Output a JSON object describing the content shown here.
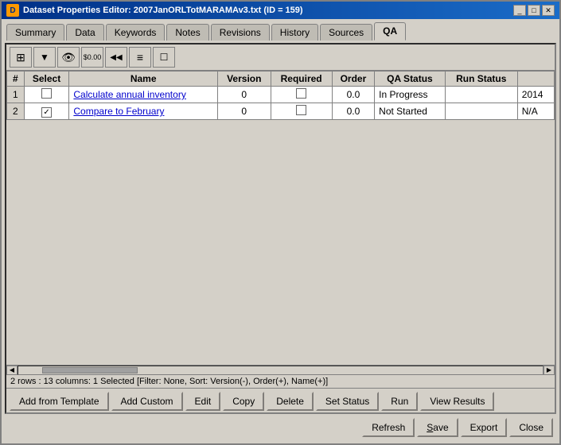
{
  "window": {
    "title": "Dataset Properties Editor: 2007JanORLTotMARAMAv3.txt (ID = 159)",
    "app_icon": "D"
  },
  "title_buttons": {
    "minimize": "_",
    "restore": "□",
    "close": "✕"
  },
  "tabs": [
    {
      "id": "summary",
      "label": "Summary",
      "active": false
    },
    {
      "id": "data",
      "label": "Data",
      "active": false
    },
    {
      "id": "keywords",
      "label": "Keywords",
      "active": false
    },
    {
      "id": "notes",
      "label": "Notes",
      "active": false
    },
    {
      "id": "revisions",
      "label": "Revisions",
      "active": false
    },
    {
      "id": "history",
      "label": "History",
      "active": false
    },
    {
      "id": "sources",
      "label": "Sources",
      "active": false
    },
    {
      "id": "qa",
      "label": "QA",
      "active": true
    }
  ],
  "toolbar_icons": [
    {
      "id": "columns-icon",
      "symbol": "⊞"
    },
    {
      "id": "filter-icon",
      "symbol": "▼"
    },
    {
      "id": "eye-icon",
      "symbol": "👁"
    },
    {
      "id": "price-icon",
      "symbol": "$0.00"
    },
    {
      "id": "rewind-icon",
      "symbol": "◀◀"
    },
    {
      "id": "list-icon",
      "symbol": "≡"
    },
    {
      "id": "checkbox-icon",
      "symbol": "☐"
    }
  ],
  "table": {
    "columns": [
      "#",
      "Select",
      "Name",
      "Version",
      "Required",
      "Order",
      "QA Status",
      "Run Status",
      ""
    ],
    "rows": [
      {
        "num": "1",
        "select": false,
        "name": "Calculate annual inventory",
        "version": "0",
        "required": false,
        "order": "0.0",
        "qa_status": "In Progress",
        "run_status": "",
        "extra": "2014"
      },
      {
        "num": "2",
        "select": true,
        "name": "Compare to February",
        "version": "0",
        "required": false,
        "order": "0.0",
        "qa_status": "Not Started",
        "run_status": "",
        "extra": "N/A"
      }
    ]
  },
  "status_bar": "2 rows : 13 columns: 1 Selected [Filter: None, Sort: Version(-), Order(+), Name(+)]",
  "bottom_toolbar1": {
    "buttons": [
      {
        "id": "add-template-btn",
        "label": "Add from Template"
      },
      {
        "id": "add-custom-btn",
        "label": "Add Custom"
      },
      {
        "id": "edit-btn",
        "label": "Edit"
      },
      {
        "id": "copy-btn",
        "label": "Copy"
      },
      {
        "id": "delete-btn",
        "label": "Delete"
      },
      {
        "id": "set-status-btn",
        "label": "Set Status"
      },
      {
        "id": "run-btn",
        "label": "Run"
      },
      {
        "id": "view-results-btn",
        "label": "View Results"
      }
    ]
  },
  "bottom_toolbar2": {
    "buttons": [
      {
        "id": "refresh-btn",
        "label": "Refresh"
      },
      {
        "id": "save-btn",
        "label": "Save"
      },
      {
        "id": "export-btn",
        "label": "Export"
      },
      {
        "id": "close-btn",
        "label": "Close"
      }
    ]
  }
}
